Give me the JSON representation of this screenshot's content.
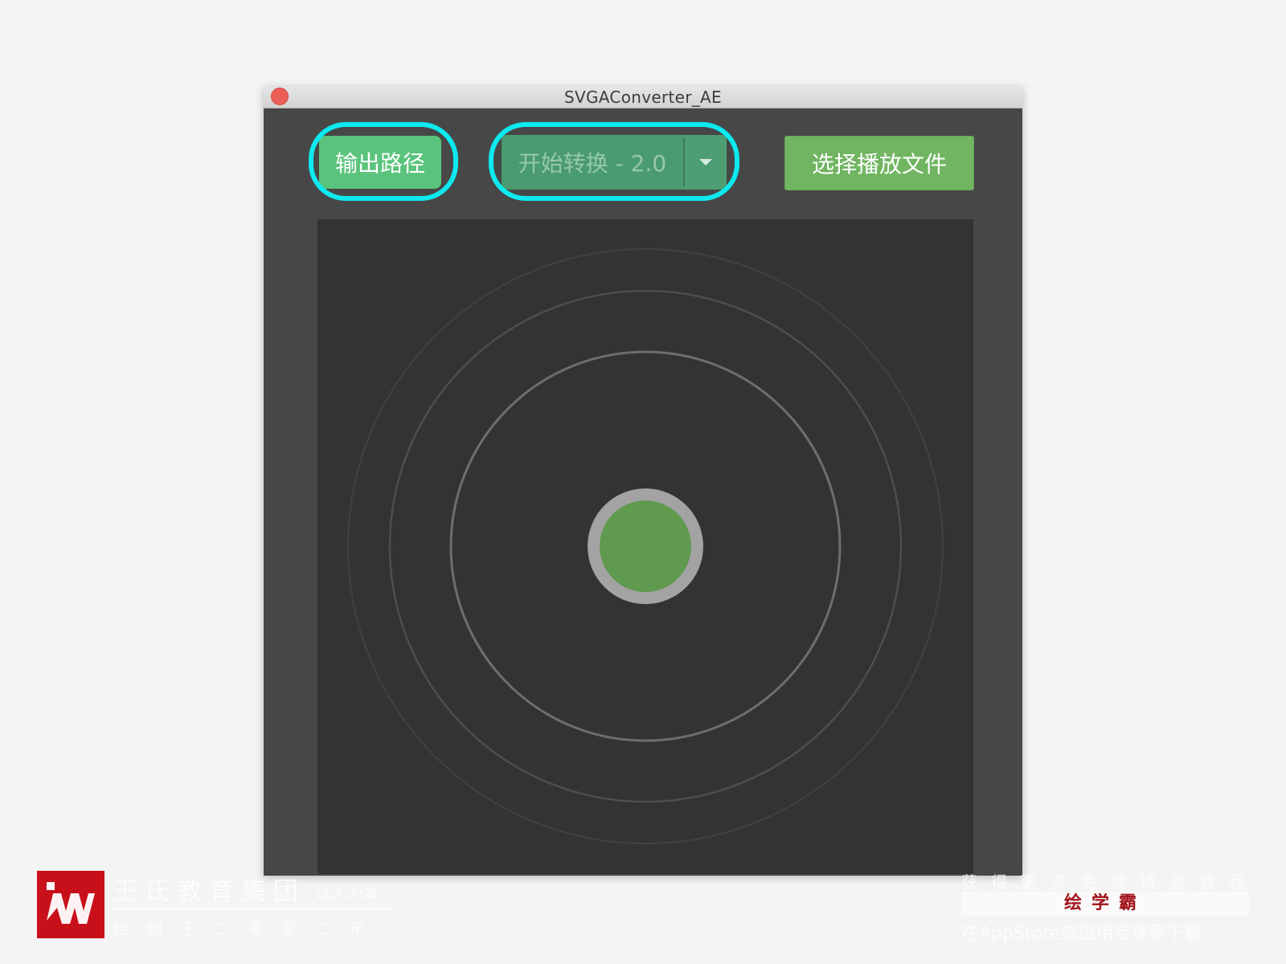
{
  "window": {
    "title": "SVGAConverter_AE"
  },
  "toolbar": {
    "output_path_label": "输出路径",
    "start_convert_label": "开始转换 - 2.0",
    "select_file_label": "选择播放文件"
  },
  "colors": {
    "output_button": "#5bc47c",
    "convert_button": "#4a9b6f",
    "select_button": "#71b562",
    "highlight_ring": "#0ce9ef",
    "canvas_bg": "#333333",
    "center_dot": "#5f9a4e"
  },
  "watermark_left": {
    "name": "王氏教育集团",
    "motto": "以人为本",
    "since": "始创于二零零二年"
  },
  "watermark_right": {
    "top": "获得更多免费精品教程",
    "brand": "绘学霸",
    "bottom": "在AppStore或应用宝搜索下载"
  }
}
